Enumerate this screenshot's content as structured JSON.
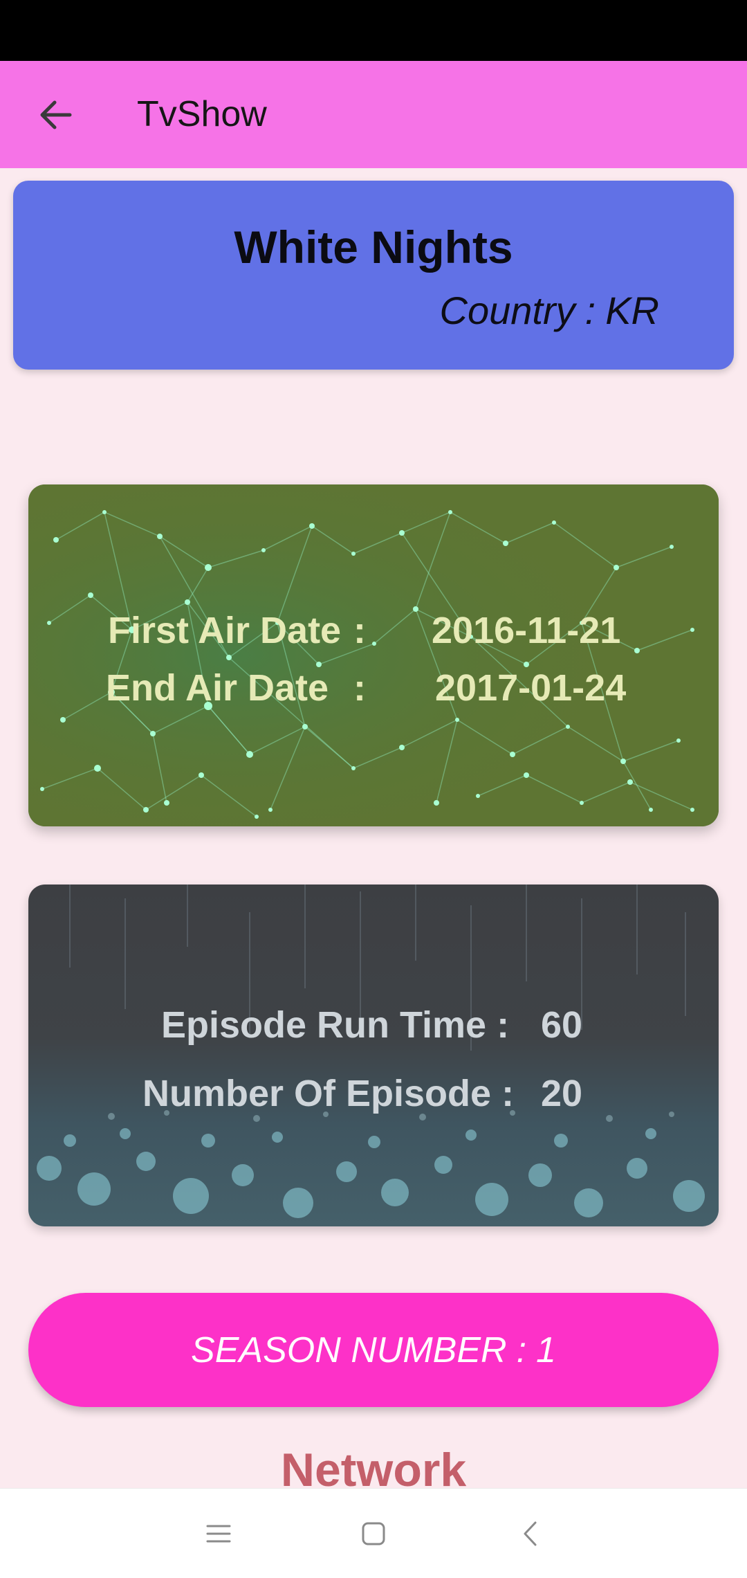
{
  "app_bar": {
    "title": "TvShow",
    "back_icon": "arrow-left-icon",
    "background": "#f673e7"
  },
  "show": {
    "name": "White Nights",
    "country_label": "Country",
    "country_separator": ":",
    "country_value": "KR"
  },
  "air_dates": {
    "first_label": "First Air Date",
    "first_separator": ":",
    "first_value": "2016-11-21",
    "end_label": "End Air Date",
    "end_separator": ":",
    "end_value": "2017-01-24"
  },
  "episodes": {
    "runtime_label": "Episode Run Time :",
    "runtime_value": "60",
    "count_label": "Number Of Episode :",
    "count_value": "20"
  },
  "season": {
    "label": "SEASON NUMBER",
    "separator": ":",
    "value": "1",
    "color": "#fd31c8"
  },
  "network": {
    "title": "Network"
  },
  "nav_bar": {
    "menu_icon": "menu-icon",
    "home_icon": "home-square-icon",
    "back_icon": "chevron-left-icon"
  },
  "colors": {
    "background": "#fbeaef",
    "header_card": "#6171e6",
    "network_title": "#c45f6a"
  }
}
